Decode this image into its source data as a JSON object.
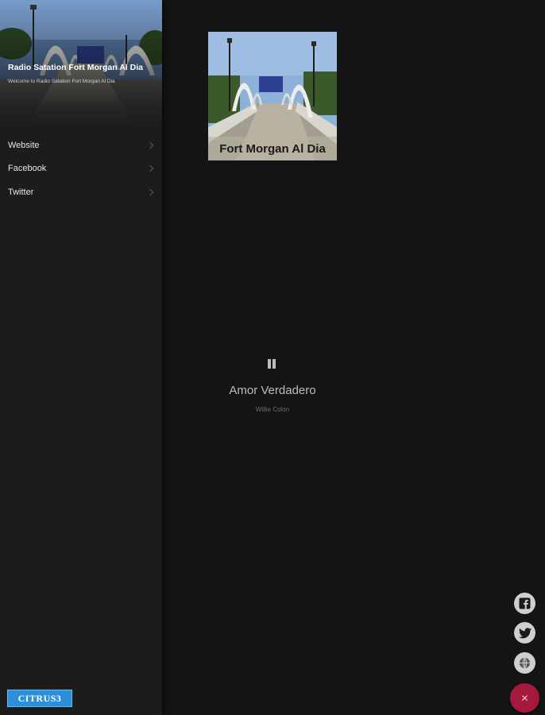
{
  "drawer": {
    "title": "Radio Satation Fort Morgan Al Dia",
    "subtitle": "Welcome to Radio Satation Fort Morgan Al Dia",
    "header_watermark": "Fort Morgan Al Dia",
    "menu": [
      {
        "label": "Website",
        "icon": "chevron-right-icon"
      },
      {
        "label": "Facebook",
        "icon": "chevron-right-icon"
      },
      {
        "label": "Twitter",
        "icon": "chevron-right-icon"
      }
    ],
    "badge": "CITRUS3"
  },
  "player": {
    "artwork_caption": "Fort Morgan Al Dia",
    "state_icon": "pause-icon",
    "song_title": "Amor Verdadero",
    "artist": "Willie Colon"
  },
  "social": [
    {
      "name": "facebook-icon",
      "glyph": "f"
    },
    {
      "name": "twitter-icon",
      "glyph": "🐦"
    },
    {
      "name": "globe-icon",
      "glyph": "🌐"
    }
  ],
  "fab": {
    "icon": "close-icon",
    "glyph": "✕"
  },
  "colors": {
    "background": "#141414",
    "drawer": "#1c1c1c",
    "accent": "#a4193d",
    "badge": "#2b8fd9"
  }
}
